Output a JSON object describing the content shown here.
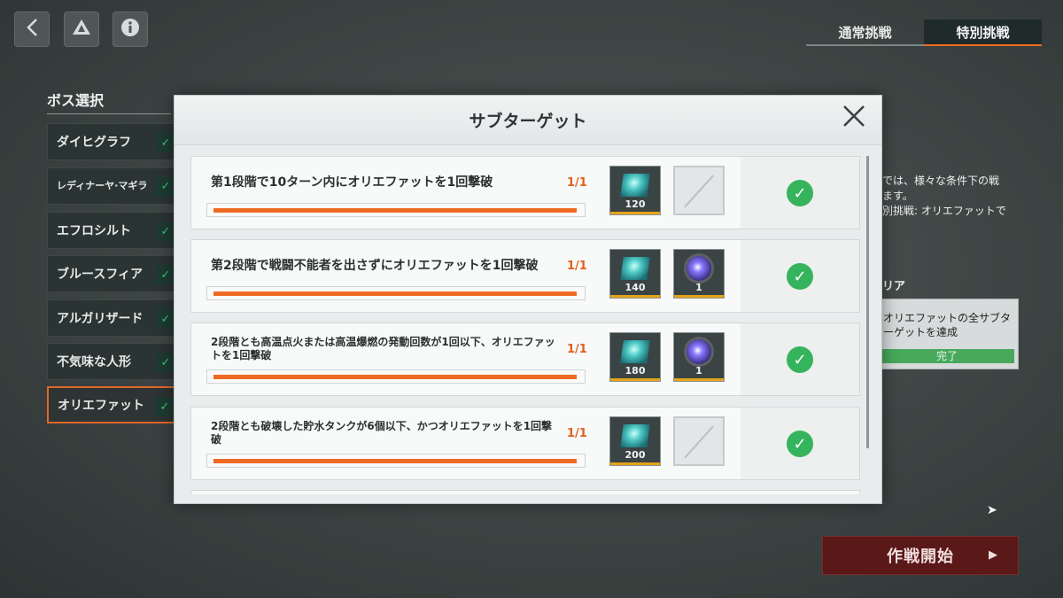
{
  "tabs": {
    "normal": "通常挑戦",
    "special": "特別挑戦"
  },
  "boss_select": {
    "title": "ボス選択",
    "items": [
      "ダイヒグラフ",
      "レディナーヤ·マギラ",
      "エフロシルト",
      "ブルースフィア",
      "アルガリザード",
      "不気味な人形",
      "オリエファット"
    ]
  },
  "right_panel": {
    "desc": "では、様々な条件下の戦\nます。\n別挑戦: オリエファットで",
    "clear_heading": "リア",
    "clear_text": "オリエファットの全サブタ\nーゲットを達成",
    "clear_status": "完了"
  },
  "start_button": "作戦開始",
  "modal": {
    "title": "サブターゲット",
    "rows": [
      {
        "desc": "第1段階で10ターン内にオリエファットを1回撃破",
        "count": "1/1",
        "progress": 1.0,
        "rewards": [
          {
            "type": "crystal",
            "qty": "120"
          },
          {
            "type": "empty",
            "qty": ""
          }
        ]
      },
      {
        "desc": "第2段階で戦闘不能者を出さずにオリエファットを1回撃破",
        "count": "1/1",
        "progress": 1.0,
        "rewards": [
          {
            "type": "crystal",
            "qty": "140"
          },
          {
            "type": "orb",
            "qty": "1"
          }
        ]
      },
      {
        "desc": "2段階とも高温点火または高温爆燃の発動回数が1回以下、オリエファットを1回撃破",
        "count": "1/1",
        "progress": 1.0,
        "rewards": [
          {
            "type": "crystal",
            "qty": "180"
          },
          {
            "type": "orb",
            "qty": "1"
          }
        ]
      },
      {
        "desc": "2段階とも破壊した貯水タンクが6個以下、かつオリエファットを1回撃破",
        "count": "1/1",
        "progress": 1.0,
        "rewards": [
          {
            "type": "crystal",
            "qty": "200"
          },
          {
            "type": "empty",
            "qty": ""
          }
        ]
      }
    ]
  }
}
